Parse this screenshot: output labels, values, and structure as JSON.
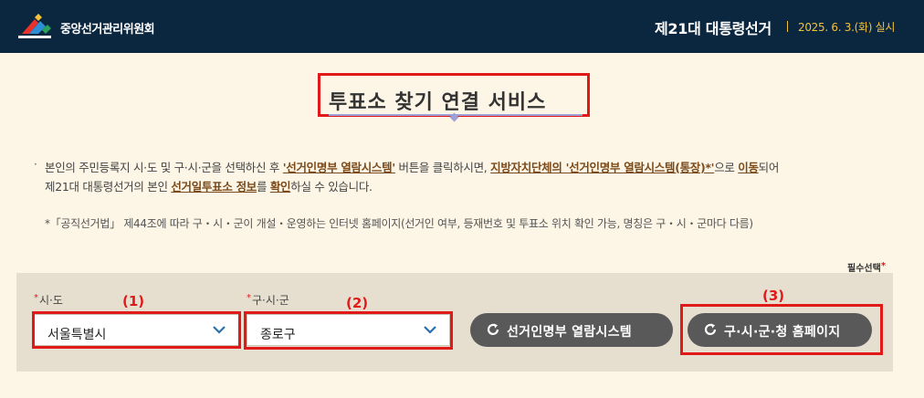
{
  "header": {
    "org_name": "중앙선거관리위원회",
    "election_title": "제21대 대통령선거",
    "election_date": "2025. 6. 3.(화) 실시"
  },
  "page_title": "투표소 찾기 연결 서비스",
  "description": {
    "line1": [
      {
        "text": "본인의 주민등록지 시·도 및 구·시·군을 선택하신 후 ",
        "style": "plain"
      },
      {
        "text": "'선거인명부 열람시스템'",
        "style": "link"
      },
      {
        "text": " 버튼을 클릭하시면, ",
        "style": "plain"
      },
      {
        "text": "지방자치단체의 '선거인명부 열람시스템(통장)*'",
        "style": "link"
      },
      {
        "text": "으로 ",
        "style": "plain"
      },
      {
        "text": "이동",
        "style": "link"
      },
      {
        "text": "되어",
        "style": "plain"
      }
    ],
    "line2": [
      {
        "text": "제21대 대통령선거의 본인 ",
        "style": "plain"
      },
      {
        "text": "선거일투표소 정보",
        "style": "link"
      },
      {
        "text": "를 ",
        "style": "plain"
      },
      {
        "text": "확인",
        "style": "link"
      },
      {
        "text": "하실 수 있습니다.",
        "style": "plain"
      }
    ],
    "note": "*「공직선거법」 제44조에 따라 구・시・군이 개설・운영하는 인터넷 홈페이지(선거인 여부, 등재번호 및 투표소 위치 확인 가능, 명칭은 구・시・군마다 다름)"
  },
  "required_label": "필수선택",
  "required_star": "*",
  "form": {
    "sido": {
      "label": "시·도",
      "star": "*",
      "value": "서울특별시",
      "annotation": "(1)"
    },
    "gusigun": {
      "label": "구·시·군",
      "star": "*",
      "value": "종로구",
      "annotation": "(2)"
    },
    "btn_registry": {
      "label": "선거인명부 열람시스템",
      "icon": "refresh-icon"
    },
    "btn_homepage": {
      "label": "구·시·군·청 홈페이지",
      "icon": "refresh-icon",
      "annotation": "(3)"
    }
  },
  "colors": {
    "header_bg": "#0b2740",
    "page_bg": "#fdf6e6",
    "panel_bg": "#e6dfd0",
    "accent_red": "#e11919",
    "date_yellow": "#f3c23a",
    "link_brown": "#7a4a1a",
    "button_gray": "#595959"
  }
}
